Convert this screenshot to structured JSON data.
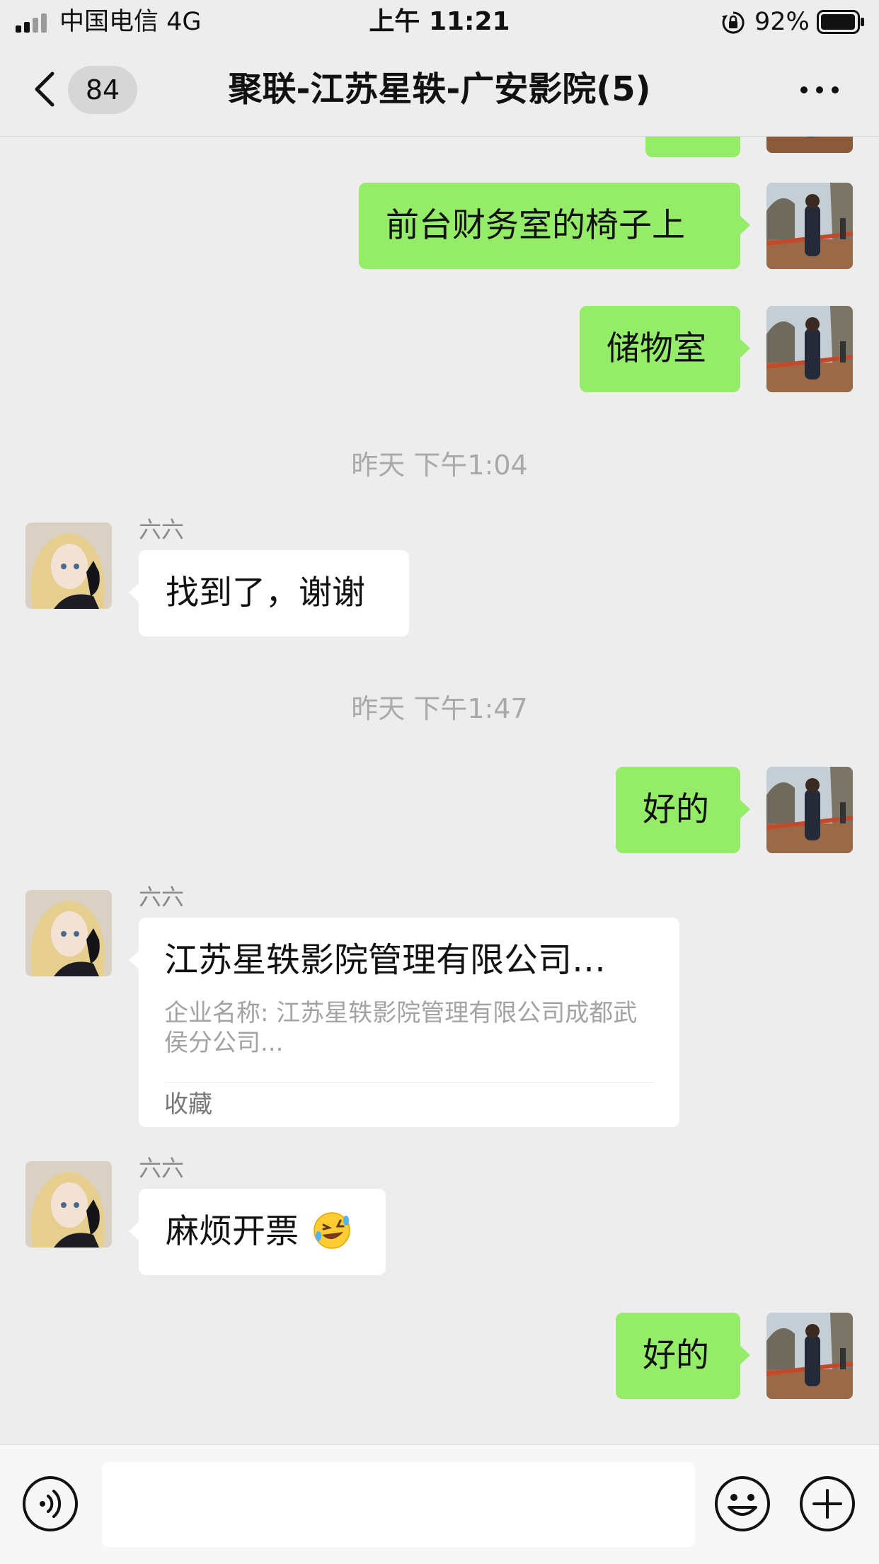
{
  "status_bar": {
    "carrier": "中国电信   4G",
    "time": "上午 11:21",
    "battery": "92%"
  },
  "nav": {
    "unread_count": "84",
    "title": "聚联-江苏星轶-广安影院(5)"
  },
  "messages": {
    "m1": "前台财务室的椅子上",
    "m2": "储物室",
    "ts1": "昨天 下午1:04",
    "sender1": "六六",
    "m3": "找到了，谢谢",
    "ts2": "昨天 下午1:47",
    "m4": "好的",
    "sender2": "六六",
    "card": {
      "title": "江苏星轶影院管理有限公司…",
      "description": "企业名称: 江苏星轶影院管理有限公司成都武侯分公司...",
      "footer": "收藏"
    },
    "sender3": "六六",
    "m5": "麻烦开票",
    "m6": "好的"
  },
  "input": {
    "placeholder": ""
  },
  "colors": {
    "outgoing_bubble": "#95ec69",
    "incoming_bubble": "#ffffff",
    "background": "#ededed"
  }
}
